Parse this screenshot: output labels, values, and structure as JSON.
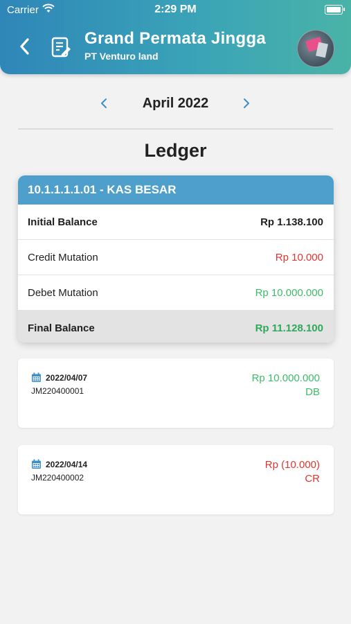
{
  "status_bar": {
    "carrier": "Carrier",
    "time": "2:29 PM"
  },
  "header": {
    "title": "Grand Permata Jingga",
    "subtitle": "PT Venturo land"
  },
  "month_selector": {
    "month": "April 2022"
  },
  "page_title": "Ledger",
  "account": {
    "name": "10.1.1.1.1.01 - KAS BESAR",
    "rows": [
      {
        "label": "Initial Balance",
        "value": "Rp 1.138.100"
      },
      {
        "label": "Credit Mutation",
        "value": "Rp 10.000"
      },
      {
        "label": "Debet Mutation",
        "value": "Rp 10.000.000"
      },
      {
        "label": "Final Balance",
        "value": "Rp 11.128.100"
      }
    ]
  },
  "transactions": [
    {
      "date": "2022/04/07",
      "ref": "JM220400001",
      "amount": "Rp 10.000.000",
      "type": "DB"
    },
    {
      "date": "2022/04/14",
      "ref": "JM220400002",
      "amount": "Rp (10.000)",
      "type": "CR"
    }
  ],
  "colors": {
    "header_start": "#2f86b8",
    "header_end": "#49b3a8",
    "account_header": "#4e9fcb",
    "credit_red": "#e3342f",
    "debit_green": "#3dbb6a"
  },
  "icons": [
    "wifi-icon",
    "battery-icon",
    "back-arrow-icon",
    "document-list-icon",
    "chevron-left-icon",
    "chevron-right-icon",
    "calendar-icon"
  ]
}
